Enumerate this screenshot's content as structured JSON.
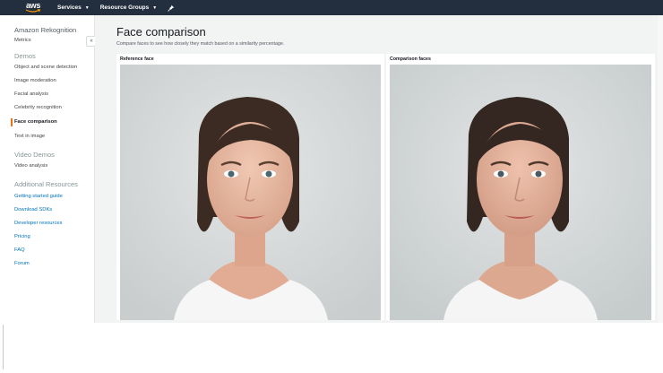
{
  "topnav": {
    "logo_text": "aws",
    "services_label": "Services",
    "resource_groups_label": "Resource Groups",
    "icons": [
      "aws-logo",
      "chevron-down-icon",
      "pin-icon"
    ]
  },
  "sidebar": {
    "title": "Amazon Rekognition",
    "collapse_glyph": "«",
    "metrics_label": "Metrics",
    "demos_heading": "Demos",
    "demo_items": [
      "Object and scene detection",
      "Image moderation",
      "Facial analysis",
      "Celebrity recognition",
      "Face comparison",
      "Text in image"
    ],
    "active_item": "Face comparison",
    "video_heading": "Video Demos",
    "video_items": [
      "Video analysis"
    ],
    "resources_heading": "Additional Resources",
    "resource_links": [
      "Getting started guide",
      "Download SDKs",
      "Developer resources",
      "Pricing",
      "FAQ",
      "Forum"
    ]
  },
  "main": {
    "title": "Face comparison",
    "subtitle": "Compare faces to see how closely they match based on a similarity percentage.",
    "reference_label": "Reference face",
    "comparison_label": "Comparison faces"
  },
  "colors": {
    "nav_bg": "#232f3e",
    "accent": "#ec7211",
    "link": "#0073bb",
    "content_bg": "#f2f3f3"
  }
}
